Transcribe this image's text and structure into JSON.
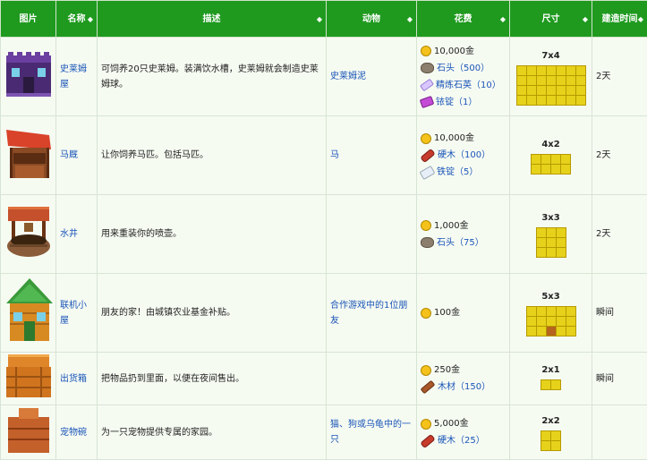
{
  "headers": {
    "picture": "图片",
    "name": "名称",
    "description": "描述",
    "animals": "动物",
    "cost": "花费",
    "size": "尺寸",
    "build_time": "建造时间"
  },
  "sort_icon": "◆",
  "rows": [
    {
      "name": "史莱姆屋",
      "description": "可饲养20只史莱姆。装满饮水槽，史莱姆就会制造史莱姆球。",
      "animals": "史莱姆泥",
      "costs": [
        {
          "icon": "gold-coin-icon",
          "text": "10,000金"
        },
        {
          "icon": "stone-icon",
          "text": "石头（500）"
        },
        {
          "icon": "refined-quartz-icon",
          "text": "精炼石英（10）"
        },
        {
          "icon": "iridium-bar-icon",
          "text": "铱锭（1）"
        }
      ],
      "size_label": "7x4",
      "build_time": "2天"
    },
    {
      "name": "马厩",
      "description": "让你饲养马匹。包括马匹。",
      "animals": "马",
      "costs": [
        {
          "icon": "gold-coin-icon",
          "text": "10,000金"
        },
        {
          "icon": "hardwood-icon",
          "text": "硬木（100）"
        },
        {
          "icon": "iron-bar-icon",
          "text": "铁锭（5）"
        }
      ],
      "size_label": "4x2",
      "build_time": "2天"
    },
    {
      "name": "水井",
      "description": "用来重装你的喷壶。",
      "animals": "",
      "costs": [
        {
          "icon": "gold-coin-icon",
          "text": "1,000金"
        },
        {
          "icon": "stone-icon",
          "text": "石头（75）"
        }
      ],
      "size_label": "3x3",
      "build_time": "2天"
    },
    {
      "name": "联机小屋",
      "description": "朋友的家！由城镇农业基金补贴。",
      "animals": "合作游戏中的1位朋友",
      "costs": [
        {
          "icon": "gold-coin-icon",
          "text": "100金"
        }
      ],
      "size_label": "5x3",
      "build_time": "瞬间"
    },
    {
      "name": "出货箱",
      "description": "把物品扔到里面，以便在夜间售出。",
      "animals": "",
      "costs": [
        {
          "icon": "gold-coin-icon",
          "text": "250金"
        },
        {
          "icon": "wood-icon",
          "text": "木材（150）"
        }
      ],
      "size_label": "2x1",
      "build_time": "瞬间"
    },
    {
      "name": "宠物碗",
      "description": "为一只宠物提供专属的家园。",
      "animals": "猫、狗或乌龟中的一只",
      "costs": [
        {
          "icon": "gold-coin-icon",
          "text": "5,000金"
        },
        {
          "icon": "hardwood-icon",
          "text": "硬木（25）"
        }
      ],
      "size_label": "2x2",
      "build_time": ""
    }
  ]
}
